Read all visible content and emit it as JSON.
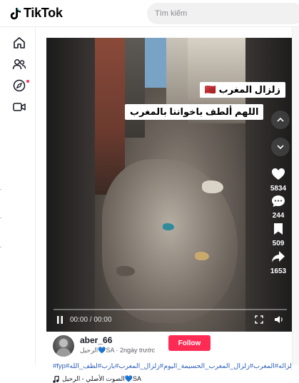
{
  "header": {
    "brand": "TikTok",
    "search_placeholder": "Tìm kiếm"
  },
  "sidebar": {
    "items": [
      {
        "icon": "home-icon"
      },
      {
        "icon": "following-icon"
      },
      {
        "icon": "explore-icon"
      },
      {
        "icon": "live-icon"
      }
    ]
  },
  "video": {
    "caption_title": "زلزال المغرب 🇲🇦",
    "caption_prayer": "اللهم ألطف باخواننا بالمغرب",
    "time": "00:00 / 00:00",
    "actions": {
      "likes": "5834",
      "comments": "244",
      "saves": "509",
      "shares": "1653"
    }
  },
  "post": {
    "username": "aber_66",
    "subline": "الرحيل💙SA · 2ngày trước",
    "follow_label": "Follow",
    "hashtags": "#fyp#زلزال_المغرب#زلزاله#المغرب#زلزال_المغرب_الحسيمة_اليوم#زلزال_المغرب#بارب#لطف_الله",
    "music": "الصوت الأصلي - الرحيل💙SA"
  },
  "colors": {
    "accent": "#fe2c55",
    "hashtag": "#2b5db9"
  }
}
